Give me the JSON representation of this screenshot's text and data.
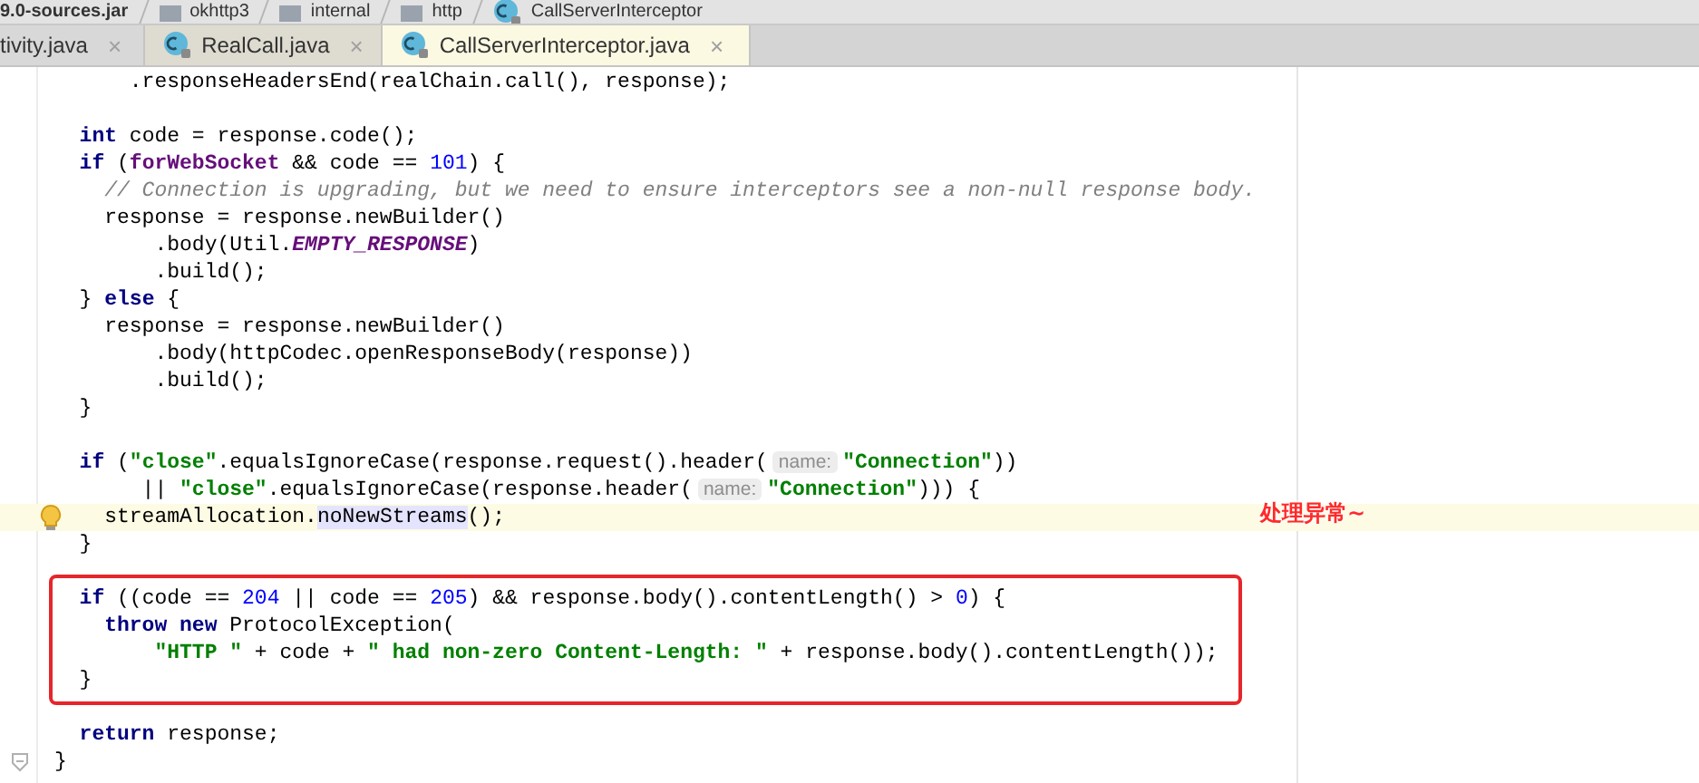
{
  "breadcrumbs": [
    {
      "label": "9.0-sources.jar"
    },
    {
      "label": "okhttp3"
    },
    {
      "label": "internal"
    },
    {
      "label": "http"
    },
    {
      "label": "CallServerInterceptor"
    }
  ],
  "tabs": [
    {
      "label": "tivity.java",
      "selected": false
    },
    {
      "label": "RealCall.java",
      "selected": false
    },
    {
      "label": "CallServerInterceptor.java",
      "selected": true
    }
  ],
  "close_glyph": "×",
  "editor": {
    "sections": [
      {
        "kind": "plain",
        "lines": [
          {
            "tokens": [
              {
                "kind": "plain",
                "text": "      .responseHeadersEnd(realChain.call(), response);"
              }
            ],
            "current": false
          }
        ]
      },
      {
        "kind": "plain",
        "lines": [
          {
            "tokens": [
              {
                "kind": "keyword",
                "text": "  int"
              },
              {
                "kind": "plain",
                "text": " code = response.code();"
              }
            ],
            "current": false
          },
          {
            "tokens": [
              {
                "kind": "keyword",
                "text": "  if"
              },
              {
                "kind": "plain",
                "text": " ("
              },
              {
                "kind": "field",
                "text": "forWebSocket"
              },
              {
                "kind": "plain",
                "text": " && code == "
              },
              {
                "kind": "number",
                "text": "101"
              },
              {
                "kind": "plain",
                "text": ") {"
              }
            ],
            "current": false
          },
          {
            "tokens": [
              {
                "kind": "comment",
                "text": "    // Connection is upgrading, but we need to ensure interceptors see a non-null response body."
              }
            ],
            "current": false
          },
          {
            "tokens": [
              {
                "kind": "plain",
                "text": "    response = response.newBuilder()"
              }
            ],
            "current": false
          },
          {
            "tokens": [
              {
                "kind": "plain",
                "text": "        .body(Util."
              },
              {
                "kind": "constant",
                "text": "EMPTY_RESPONSE"
              },
              {
                "kind": "plain",
                "text": ")"
              }
            ],
            "current": false
          },
          {
            "tokens": [
              {
                "kind": "plain",
                "text": "        .build();"
              }
            ],
            "current": false
          },
          {
            "tokens": [
              {
                "kind": "plain",
                "text": "  } "
              },
              {
                "kind": "keyword",
                "text": "else"
              },
              {
                "kind": "plain",
                "text": " {"
              }
            ],
            "current": false
          },
          {
            "tokens": [
              {
                "kind": "plain",
                "text": "    response = response.newBuilder()"
              }
            ],
            "current": false
          },
          {
            "tokens": [
              {
                "kind": "plain",
                "text": "        .body(httpCodec.openResponseBody(response))"
              }
            ],
            "current": false
          },
          {
            "tokens": [
              {
                "kind": "plain",
                "text": "        .build();"
              }
            ],
            "current": false
          },
          {
            "tokens": [
              {
                "kind": "plain",
                "text": "  }"
              }
            ],
            "current": false
          }
        ]
      },
      {
        "kind": "plain",
        "lines": [
          {
            "tokens": [
              {
                "kind": "keyword",
                "text": "  if"
              },
              {
                "kind": "plain",
                "text": " ("
              },
              {
                "kind": "string",
                "text": "\"close\""
              },
              {
                "kind": "plain",
                "text": ".equalsIgnoreCase(response.request().header("
              },
              {
                "kind": "hint",
                "text": "name:"
              },
              {
                "kind": "string",
                "text": "\"Connection\""
              },
              {
                "kind": "plain",
                "text": "))"
              }
            ],
            "current": false
          },
          {
            "tokens": [
              {
                "kind": "plain",
                "text": "       || "
              },
              {
                "kind": "string",
                "text": "\"close\""
              },
              {
                "kind": "plain",
                "text": ".equalsIgnoreCase(response.header("
              },
              {
                "kind": "hint",
                "text": "name:"
              },
              {
                "kind": "string",
                "text": "\"Connection\""
              },
              {
                "kind": "plain",
                "text": "))) {"
              }
            ],
            "current": false
          },
          {
            "tokens": [
              {
                "kind": "plain",
                "text": "    streamAllocation."
              },
              {
                "kind": "usage",
                "text": "noNewStreams"
              },
              {
                "kind": "plain",
                "text": "();"
              }
            ],
            "current": true,
            "note": "处理异常~"
          },
          {
            "tokens": [
              {
                "kind": "plain",
                "text": "  }"
              }
            ],
            "current": false
          }
        ]
      },
      {
        "kind": "framed",
        "lines": [
          {
            "tokens": [
              {
                "kind": "keyword",
                "text": "  if"
              },
              {
                "kind": "plain",
                "text": " ((code == "
              },
              {
                "kind": "number",
                "text": "204"
              },
              {
                "kind": "plain",
                "text": " || code == "
              },
              {
                "kind": "number",
                "text": "205"
              },
              {
                "kind": "plain",
                "text": ") && response.body().contentLength() > "
              },
              {
                "kind": "number",
                "text": "0"
              },
              {
                "kind": "plain",
                "text": ") {"
              }
            ],
            "current": false
          },
          {
            "tokens": [
              {
                "kind": "keyword",
                "text": "    throw new"
              },
              {
                "kind": "plain",
                "text": " ProtocolException("
              }
            ],
            "current": false
          },
          {
            "tokens": [
              {
                "kind": "string",
                "text": "        \"HTTP \""
              },
              {
                "kind": "plain",
                "text": " + code + "
              },
              {
                "kind": "string",
                "text": "\" had non-zero Content-Length: \""
              },
              {
                "kind": "plain",
                "text": " + response.body().contentLength());"
              }
            ],
            "current": false
          },
          {
            "tokens": [
              {
                "kind": "plain",
                "text": "  }"
              }
            ],
            "current": false
          }
        ]
      },
      {
        "kind": "plain",
        "lines": [
          {
            "tokens": [
              {
                "kind": "keyword",
                "text": "  return"
              },
              {
                "kind": "plain",
                "text": " response;"
              }
            ],
            "current": false
          },
          {
            "tokens": [
              {
                "kind": "plain",
                "text": "}"
              }
            ],
            "current": false
          }
        ]
      }
    ]
  }
}
